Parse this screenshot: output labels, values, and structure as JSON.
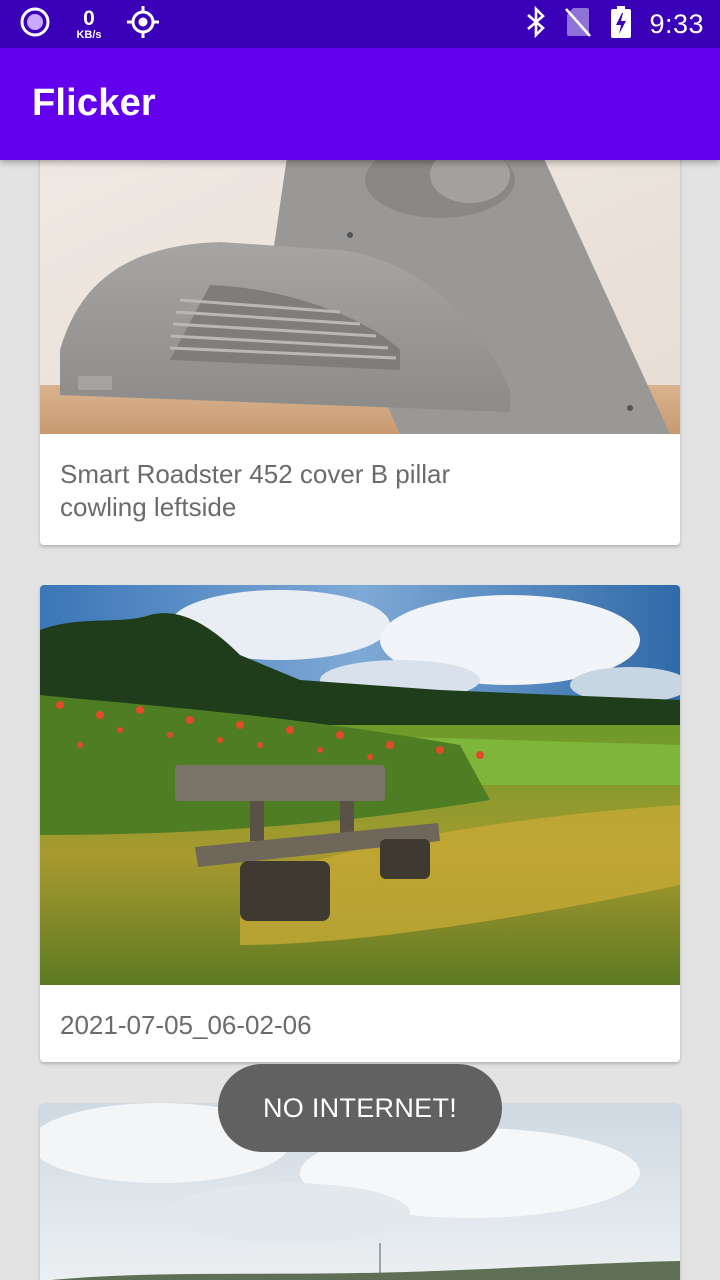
{
  "status_bar": {
    "net_speed_value": "0",
    "net_speed_unit": "KB/s",
    "time": "9:33",
    "icons": [
      "record-icon",
      "location-target-icon",
      "bluetooth-icon",
      "no-sim-icon",
      "battery-charging-icon"
    ]
  },
  "app_bar": {
    "title": "Flicker"
  },
  "feed": {
    "items": [
      {
        "caption": "Smart Roadster 452 cover B pillar cowling leftside"
      },
      {
        "caption": "2021-07-05_06-02-06"
      },
      {
        "caption": ""
      }
    ]
  },
  "toast": {
    "message": "NO INTERNET!"
  },
  "colors": {
    "status_bar": "#3a00b8",
    "app_bar": "#6200ee",
    "background": "#e3e3e3",
    "toast": "#616161"
  }
}
